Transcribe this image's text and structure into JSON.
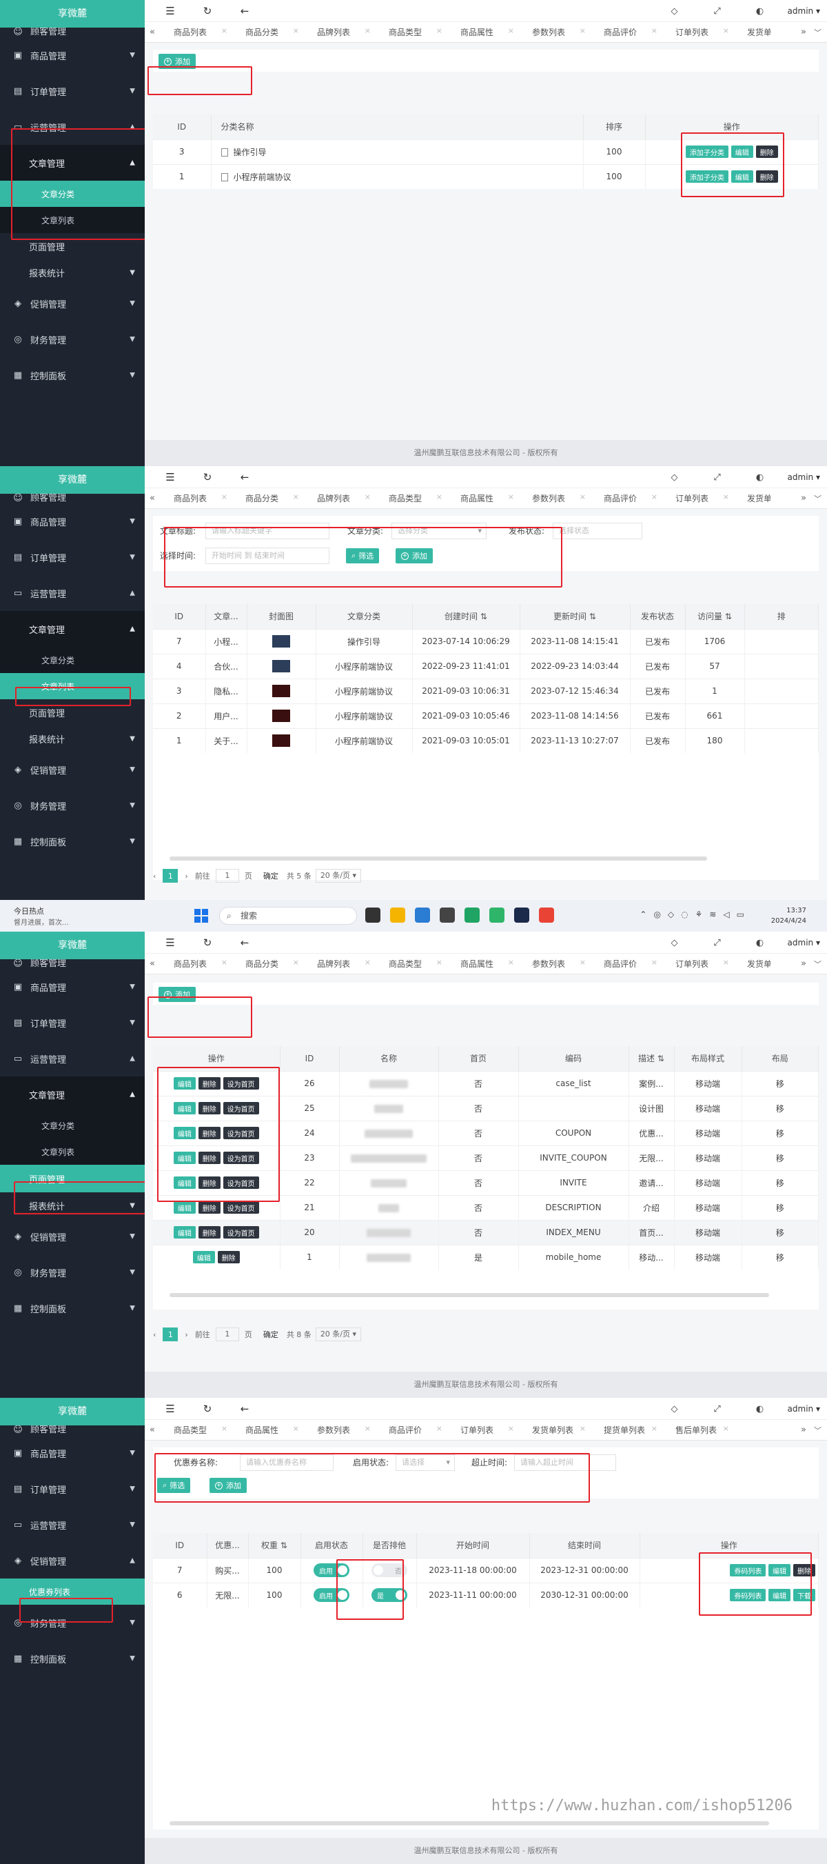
{
  "brand": "享微麓",
  "menu": {
    "customer": "顾客管理",
    "goods": "商品管理",
    "orders": "订单管理",
    "operations": "运营管理",
    "articles": "文章管理",
    "article_category": "文章分类",
    "article_list": "文章列表",
    "page_manage": "页面管理",
    "reports": "报表统计",
    "promotion": "促销管理",
    "coupon_list": "优惠券列表",
    "finance": "财务管理",
    "dashboard": "控制面板"
  },
  "topbar": {
    "user": "admin"
  },
  "tabs_a": [
    "商品列表",
    "商品分类",
    "品牌列表",
    "商品类型",
    "商品属性",
    "参数列表",
    "商品评价",
    "订单列表",
    "发货单"
  ],
  "tabs_b": [
    "商品类型",
    "商品属性",
    "参数列表",
    "商品评价",
    "订单列表",
    "发货单列表",
    "提货单列表",
    "售后单列表"
  ],
  "common": {
    "add": "添加",
    "filter": "筛选",
    "footer": "温州魔鹏互联信息技术有限公司 - 版权所有",
    "prev": "‹",
    "next": "›",
    "goto": "前往",
    "page_unit": "页",
    "confirm": "确定",
    "page_size": "20 条/页",
    "page1": "1"
  },
  "panel1": {
    "headers": [
      "ID",
      "分类名称",
      "排序",
      "操作"
    ],
    "rows": [
      {
        "id": "3",
        "name": "操作引导",
        "sort": "100"
      },
      {
        "id": "1",
        "name": "小程序前端协议",
        "sort": "100"
      }
    ],
    "ops": {
      "add_child": "添加子分类",
      "edit": "编辑",
      "delete": "删除"
    }
  },
  "panel2": {
    "filters": {
      "title_label": "文章标题:",
      "title_ph": "请输入标题关键字",
      "cat_label": "文章分类:",
      "cat_ph": "选择分类",
      "status_label": "发布状态:",
      "status_ph": "选择状态",
      "time_label": "选择时间:",
      "time_start": "开始时间",
      "time_sep": "到",
      "time_end": "结束时间"
    },
    "headers": [
      "ID",
      "文章...",
      "封面图",
      "文章分类",
      "创建时间",
      "更新时间",
      "发布状态",
      "访问量",
      "排"
    ],
    "rows": [
      {
        "id": "7",
        "title": "小程...",
        "cat": "操作引导",
        "created": "2023-07-14 10:06:29",
        "updated": "2023-11-08 14:15:41",
        "status": "已发布",
        "views": "1706"
      },
      {
        "id": "4",
        "title": "合伙...",
        "cat": "小程序前端协议",
        "created": "2022-09-23 11:41:01",
        "updated": "2022-09-23 14:03:44",
        "status": "已发布",
        "views": "57"
      },
      {
        "id": "3",
        "title": "隐私...",
        "cat": "小程序前端协议",
        "created": "2021-09-03 10:06:31",
        "updated": "2023-07-12 15:46:34",
        "status": "已发布",
        "views": "1"
      },
      {
        "id": "2",
        "title": "用户...",
        "cat": "小程序前端协议",
        "created": "2021-09-03 10:05:46",
        "updated": "2023-11-08 14:14:56",
        "status": "已发布",
        "views": "661"
      },
      {
        "id": "1",
        "title": "关于...",
        "cat": "小程序前端协议",
        "created": "2021-09-03 10:05:01",
        "updated": "2023-11-13 10:27:07",
        "status": "已发布",
        "views": "180"
      }
    ],
    "total": "共 5 条"
  },
  "panel3": {
    "headers": [
      "操作",
      "ID",
      "名称",
      "首页",
      "编码",
      "描述",
      "布局样式",
      "布局"
    ],
    "ops": {
      "edit": "编辑",
      "delete": "删除",
      "set_home": "设为首页"
    },
    "rows": [
      {
        "id": "26",
        "home": "否",
        "code": "case_list",
        "desc": "案例...",
        "layout": "移动端",
        "layout2": "移"
      },
      {
        "id": "25",
        "home": "否",
        "code": "",
        "desc": "设计图",
        "layout": "移动端",
        "layout2": "移"
      },
      {
        "id": "24",
        "home": "否",
        "code": "COUPON",
        "desc": "优惠...",
        "layout": "移动端",
        "layout2": "移"
      },
      {
        "id": "23",
        "home": "否",
        "code": "INVITE_COUPON",
        "desc": "无限...",
        "layout": "移动端",
        "layout2": "移"
      },
      {
        "id": "22",
        "home": "否",
        "code": "INVITE",
        "desc": "邀请...",
        "layout": "移动端",
        "layout2": "移"
      },
      {
        "id": "21",
        "home": "否",
        "code": "DESCRIPTION",
        "desc": "介绍",
        "layout": "移动端",
        "layout2": "移"
      },
      {
        "id": "20",
        "home": "否",
        "code": "INDEX_MENU",
        "desc": "首页...",
        "layout": "移动端",
        "layout2": "移"
      },
      {
        "id": "1",
        "home": "是",
        "code": "mobile_home",
        "desc": "移动...",
        "layout": "移动端",
        "layout2": "移"
      }
    ],
    "total": "共 8 条"
  },
  "panel4": {
    "filters": {
      "name_label": "优惠券名称:",
      "name_ph": "请输入优惠券名称",
      "status_label": "启用状态:",
      "status_ph": "请选择",
      "expire_label": "超止时间:",
      "expire_ph": "请输入超止时间"
    },
    "headers": [
      "ID",
      "优惠...",
      "权重",
      "启用状态",
      "是否排他",
      "开始时间",
      "结束时间",
      "操作"
    ],
    "rows": [
      {
        "id": "7",
        "name": "购买...",
        "weight": "100",
        "enabled": "启用",
        "exclusive": "否",
        "start": "2023-11-18 00:00:00",
        "end": "2023-12-31 00:00:00"
      },
      {
        "id": "6",
        "name": "无限...",
        "weight": "100",
        "enabled": "启用",
        "exclusive": "是",
        "start": "2023-11-11 00:00:00",
        "end": "2030-12-31 00:00:00"
      }
    ],
    "ops": {
      "codes": "券码列表",
      "edit": "编辑",
      "delete": "删除",
      "download": "下载"
    }
  },
  "taskbar": {
    "news_title": "今日热点",
    "news_sub": "督月进展，首次...",
    "search": "搜索",
    "time": "13:37",
    "date": "2024/4/24"
  },
  "watermark": "https://www.huzhan.com/ishop51206",
  "colors": {
    "accent": "#36b9a4",
    "sidebar": "#1f2530",
    "highlight": "#e5212a"
  }
}
